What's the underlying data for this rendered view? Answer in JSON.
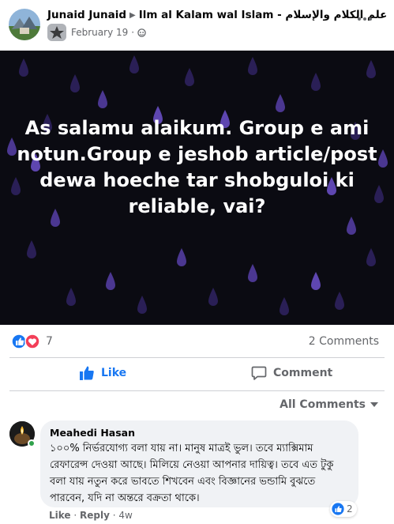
{
  "post": {
    "author": "Junaid Junaid",
    "group": "Ilm al Kalam wal Islam - علم الكلام والإسلام",
    "date": "February 19",
    "separator": "·",
    "text": "As salamu alaikum. Group e ami notun.Group e jeshob article/post dewa hoeche tar shobguloi ki reliable, vai?"
  },
  "stats": {
    "reactions_count": "7",
    "comments_count": "2 Comments"
  },
  "actions": {
    "like_label": "Like",
    "comment_label": "Comment"
  },
  "comments_filter": {
    "label": "All Comments"
  },
  "comment": {
    "author": "Meahedi Hasan",
    "text": "১০০% নির্ভরযোগ্য বলা যায় না। মানুষ মাত্রই ভুল। তবে ম্যাক্সিমাম রেফারেন্স দেওয়া আছে। মিলিয়ে নেওয়া আপনার দায়িত্ব। তবে এত টুকু বলা যায় নতুন করে ভাবতে শিখবেন এবং বিজ্ঞানের ভন্ডামি বুঝতে পারবেন, যদি না অন্তরে বক্রতা থাকে।",
    "reaction_count": "2",
    "like_label": "Like",
    "reply_label": "Reply",
    "age": "4w"
  },
  "colors": {
    "accent": "#1877f2",
    "secondary_text": "#65676b",
    "bubble": "#f0f2f5",
    "post_background": "#0b0b12"
  }
}
